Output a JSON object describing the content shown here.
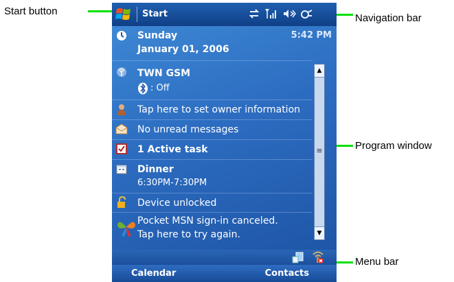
{
  "callouts": {
    "start_button": "Start button",
    "navigation_bar": "Navigation bar",
    "program_window": "Program window",
    "menu_bar": "Menu bar"
  },
  "navbar": {
    "start_label": "Start",
    "icons": [
      "sync-arrows-icon",
      "signal-icon",
      "speaker-icon",
      "power-plug-icon"
    ]
  },
  "today": {
    "day": "Sunday",
    "date": "January 01, 2006",
    "time": "5:42 PM",
    "network": "TWN GSM",
    "bluetooth_status": ": Off",
    "owner": "Tap here to set owner information",
    "messages": "No unread messages",
    "tasks": "1 Active task",
    "appointment_title": "Dinner",
    "appointment_time": "6:30PM-7:30PM",
    "lock": "Device unlocked",
    "msn_line1": "Pocket MSN sign-in canceled.",
    "msn_line2": "Tap here to try again."
  },
  "menubar": {
    "left": "Calendar",
    "right": "Contacts"
  },
  "colors": {
    "callout_line": "#00e000",
    "screen_blue": "#2e6fb8"
  }
}
